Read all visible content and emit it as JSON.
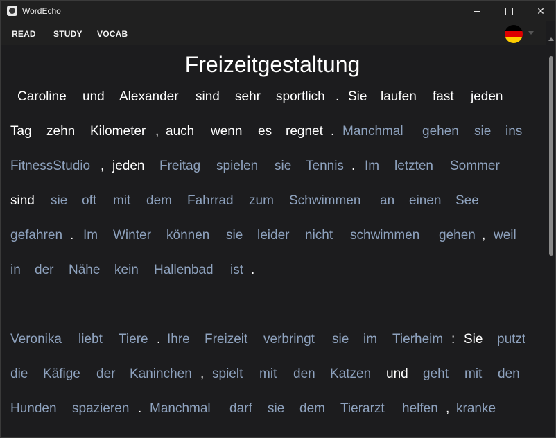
{
  "window": {
    "title": "WordEcho"
  },
  "menu": {
    "read": "READ",
    "study": "STUDY",
    "vocab": "VOCAB"
  },
  "language_flag": {
    "icon": "germany-flag-icon",
    "colors": [
      "#000000",
      "#dd0000",
      "#ffce00"
    ]
  },
  "colors": {
    "known": "#ffffff",
    "unknown": "#8ea2be",
    "background": "#1c1c1e"
  },
  "story": {
    "title": "Freizeitgestaltung",
    "lines": [
      {
        "words": [
          {
            "t": "Caroline",
            "known": true
          },
          {
            "t": "und",
            "known": true
          },
          {
            "t": "Alexander",
            "known": true
          },
          {
            "t": "sind",
            "known": true
          },
          {
            "t": "sehr",
            "known": true
          },
          {
            "t": "sportlich",
            "known": true
          },
          {
            "t": ".",
            "known": true
          },
          {
            "t": "Sie",
            "known": true
          },
          {
            "t": "laufen",
            "known": true
          },
          {
            "t": "fast",
            "known": true
          },
          {
            "t": "jeden",
            "known": true
          }
        ]
      },
      {
        "words": [
          {
            "t": "Tag",
            "known": true
          },
          {
            "t": "zehn",
            "known": true
          },
          {
            "t": "Kilometer",
            "known": true
          },
          {
            "t": ",",
            "known": true
          },
          {
            "t": "auch",
            "known": true
          },
          {
            "t": "wenn",
            "known": true
          },
          {
            "t": "es",
            "known": true
          },
          {
            "t": "regnet",
            "known": true
          },
          {
            "t": ".",
            "known": true
          },
          {
            "t": "Manchmal",
            "known": false
          },
          {
            "t": "gehen",
            "known": false
          },
          {
            "t": "sie",
            "known": false
          },
          {
            "t": "ins",
            "known": false
          }
        ]
      },
      {
        "words": [
          {
            "t": "FitnessStudio",
            "known": false
          },
          {
            "t": ",",
            "known": true
          },
          {
            "t": "jeden",
            "known": true
          },
          {
            "t": "Freitag",
            "known": false
          },
          {
            "t": "spielen",
            "known": false
          },
          {
            "t": "sie",
            "known": false
          },
          {
            "t": "Tennis",
            "known": false
          },
          {
            "t": ".",
            "known": true
          },
          {
            "t": "Im",
            "known": false
          },
          {
            "t": "letzten",
            "known": false
          },
          {
            "t": "Sommer",
            "known": false
          }
        ]
      },
      {
        "words": [
          {
            "t": "sind",
            "known": true
          },
          {
            "t": "sie",
            "known": false
          },
          {
            "t": "oft",
            "known": false
          },
          {
            "t": "mit",
            "known": false
          },
          {
            "t": "dem",
            "known": false
          },
          {
            "t": "Fahrrad",
            "known": false
          },
          {
            "t": "zum",
            "known": false
          },
          {
            "t": "Schwimmen",
            "known": false
          },
          {
            "t": "an",
            "known": false
          },
          {
            "t": "einen",
            "known": false
          },
          {
            "t": "See",
            "known": false
          }
        ]
      },
      {
        "words": [
          {
            "t": "gefahren",
            "known": false
          },
          {
            "t": ".",
            "known": true
          },
          {
            "t": "Im",
            "known": false
          },
          {
            "t": "Winter",
            "known": false
          },
          {
            "t": "können",
            "known": false
          },
          {
            "t": "sie",
            "known": false
          },
          {
            "t": "leider",
            "known": false
          },
          {
            "t": "nicht",
            "known": false
          },
          {
            "t": "schwimmen",
            "known": false
          },
          {
            "t": "gehen",
            "known": false
          },
          {
            "t": ",",
            "known": true
          },
          {
            "t": "weil",
            "known": false
          }
        ]
      },
      {
        "words": [
          {
            "t": "in",
            "known": false
          },
          {
            "t": "der",
            "known": false
          },
          {
            "t": "Nähe",
            "known": false
          },
          {
            "t": "kein",
            "known": false
          },
          {
            "t": "Hallenbad",
            "known": false
          },
          {
            "t": "ist",
            "known": false
          },
          {
            "t": ".",
            "known": true
          }
        ]
      },
      {
        "words": [
          {
            "t": "Veronika",
            "known": false
          },
          {
            "t": "liebt",
            "known": false
          },
          {
            "t": "Tiere",
            "known": false
          },
          {
            "t": ".",
            "known": true
          },
          {
            "t": "Ihre",
            "known": false
          },
          {
            "t": "Freizeit",
            "known": false
          },
          {
            "t": "verbringt",
            "known": false
          },
          {
            "t": "sie",
            "known": false
          },
          {
            "t": "im",
            "known": false
          },
          {
            "t": "Tierheim",
            "known": false
          },
          {
            "t": ":",
            "known": true
          },
          {
            "t": "Sie",
            "known": true
          },
          {
            "t": "putzt",
            "known": false
          }
        ]
      },
      {
        "words": [
          {
            "t": "die",
            "known": false
          },
          {
            "t": "Käfige",
            "known": false
          },
          {
            "t": "der",
            "known": false
          },
          {
            "t": "Kaninchen",
            "known": false
          },
          {
            "t": ",",
            "known": true
          },
          {
            "t": "spielt",
            "known": false
          },
          {
            "t": "mit",
            "known": false
          },
          {
            "t": "den",
            "known": false
          },
          {
            "t": "Katzen",
            "known": false
          },
          {
            "t": "und",
            "known": true
          },
          {
            "t": "geht",
            "known": false
          },
          {
            "t": "mit",
            "known": false
          },
          {
            "t": "den",
            "known": false
          }
        ]
      },
      {
        "words": [
          {
            "t": "Hunden",
            "known": false
          },
          {
            "t": "spazieren",
            "known": false
          },
          {
            "t": ".",
            "known": true
          },
          {
            "t": "Manchmal",
            "known": false
          },
          {
            "t": "darf",
            "known": false
          },
          {
            "t": "sie",
            "known": false
          },
          {
            "t": "dem",
            "known": false
          },
          {
            "t": "Tierarzt",
            "known": false
          },
          {
            "t": "helfen",
            "known": false
          },
          {
            "t": ",",
            "known": true
          },
          {
            "t": "kranke",
            "known": false
          }
        ]
      }
    ]
  }
}
